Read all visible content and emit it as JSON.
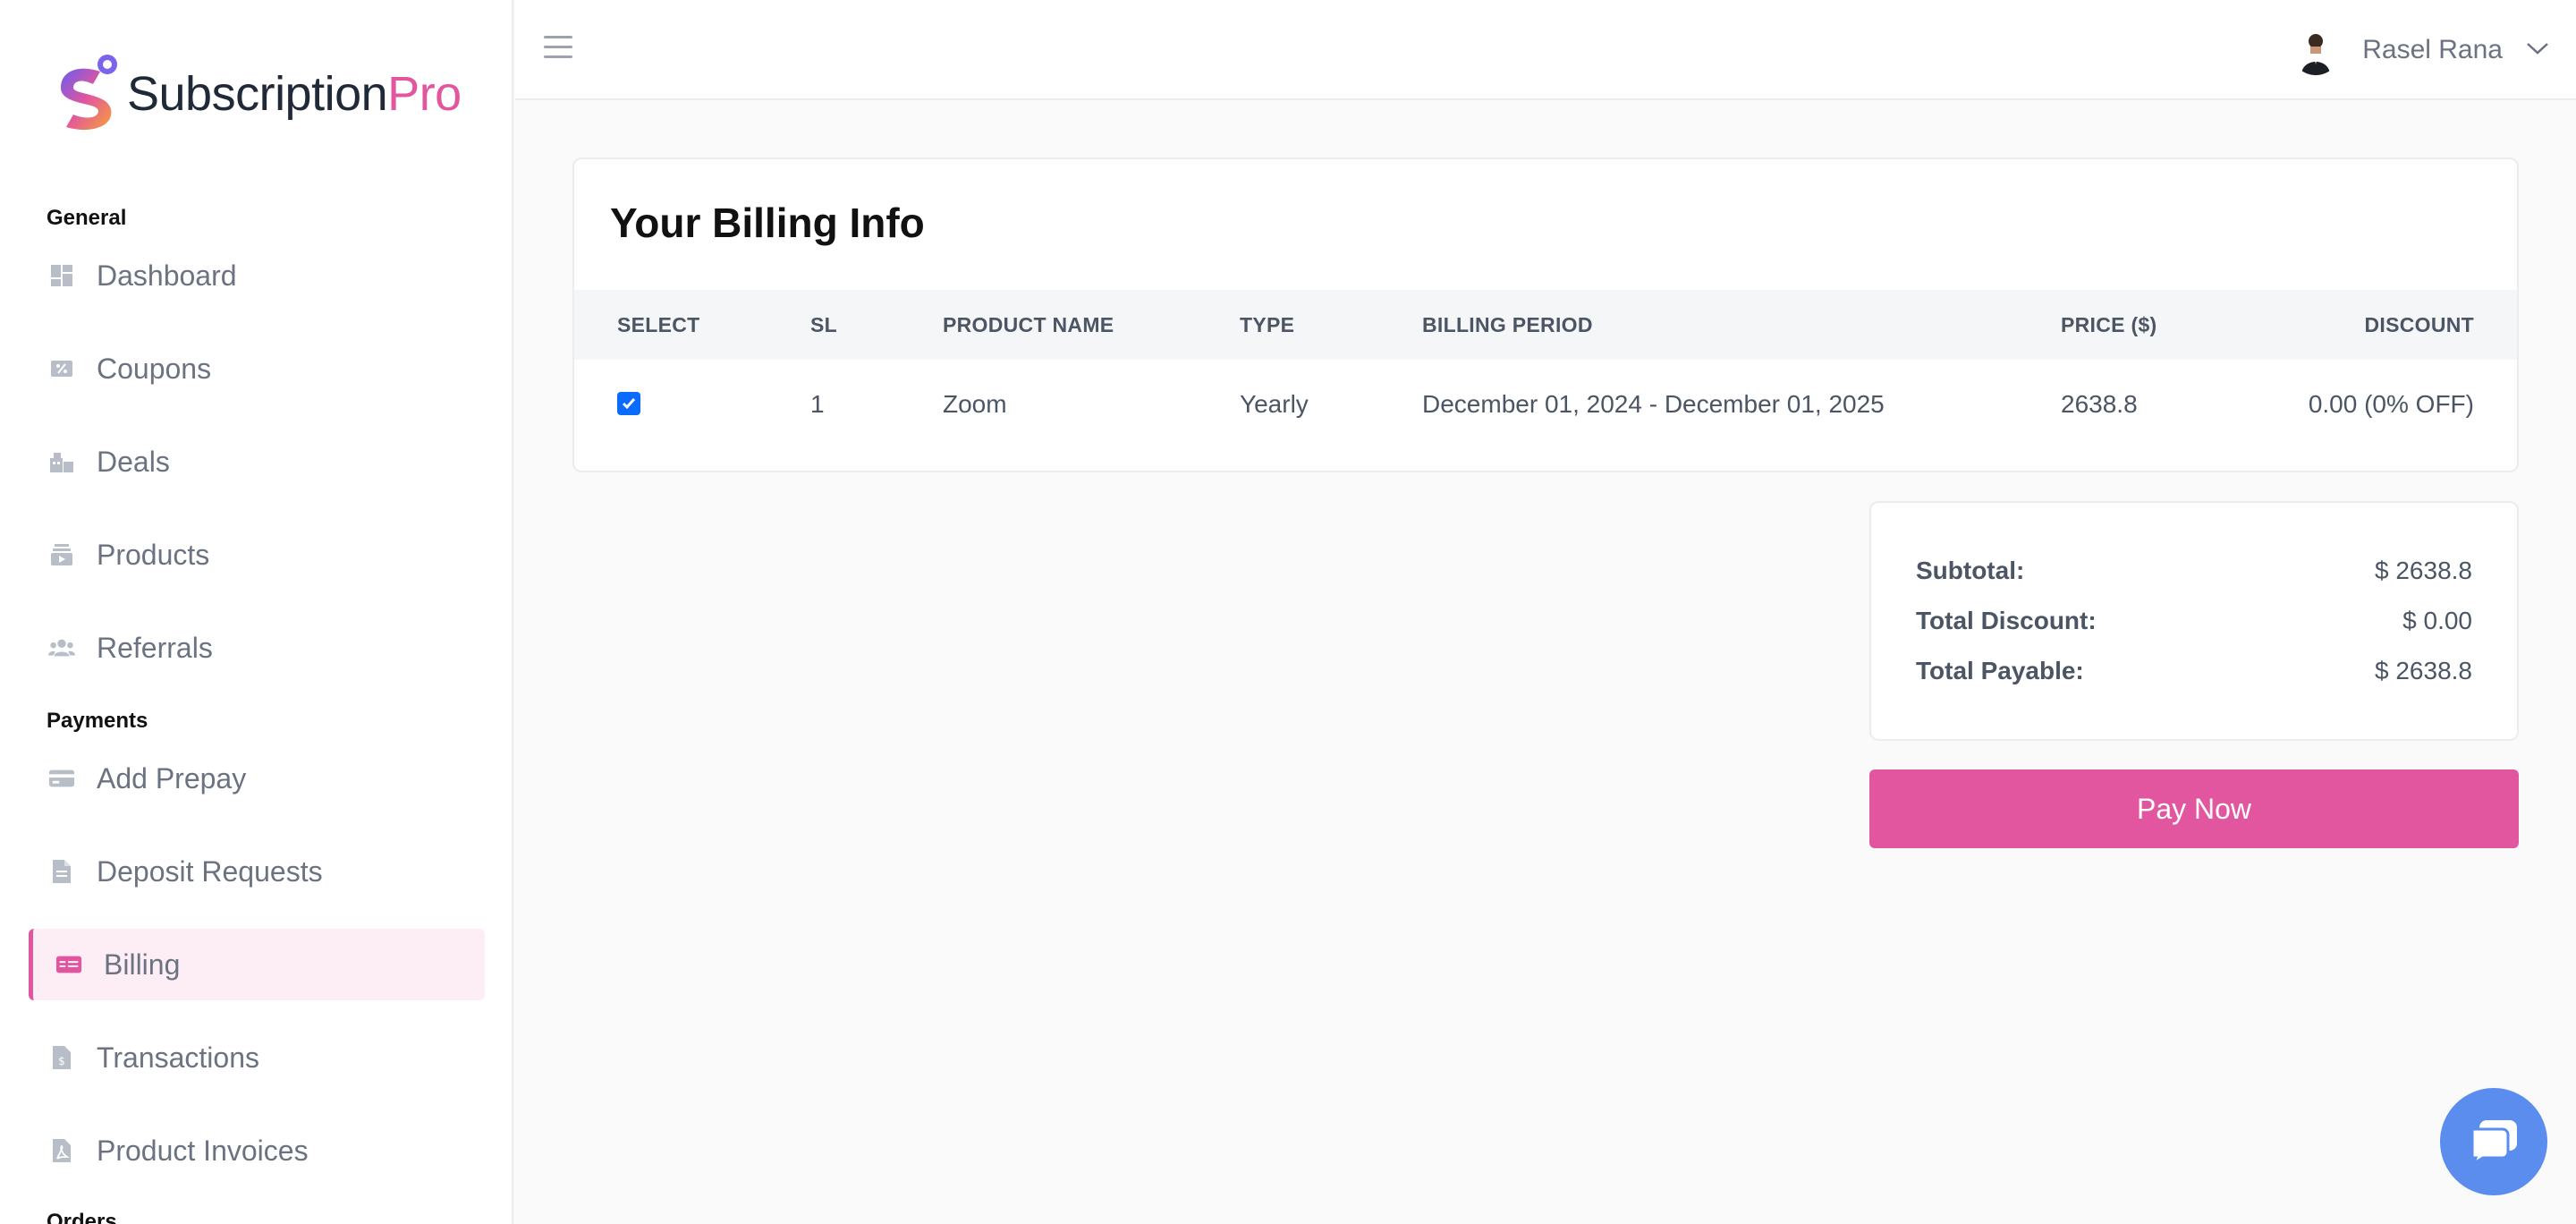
{
  "brand": {
    "name_main": "Subscription",
    "name_accent": "Pro"
  },
  "sidebar": {
    "sections": [
      {
        "title": "General"
      },
      {
        "title": "Payments"
      },
      {
        "title": "Orders"
      }
    ],
    "items": [
      {
        "label": "Dashboard",
        "icon": "dashboard-icon"
      },
      {
        "label": "Coupons",
        "icon": "coupon-icon"
      },
      {
        "label": "Deals",
        "icon": "deals-icon"
      },
      {
        "label": "Products",
        "icon": "products-icon"
      },
      {
        "label": "Referrals",
        "icon": "referrals-icon"
      },
      {
        "label": "Add Prepay",
        "icon": "card-icon"
      },
      {
        "label": "Deposit Requests",
        "icon": "document-icon"
      },
      {
        "label": "Billing",
        "icon": "billing-icon",
        "active": true
      },
      {
        "label": "Transactions",
        "icon": "invoice-dollar-icon"
      },
      {
        "label": "Product Invoices",
        "icon": "pdf-file-icon"
      }
    ]
  },
  "header": {
    "user_name": "Rasel Rana"
  },
  "billing": {
    "title": "Your Billing Info",
    "columns": [
      "SELECT",
      "SL",
      "PRODUCT NAME",
      "TYPE",
      "BILLING PERIOD",
      "PRICE ($)",
      "DISCOUNT"
    ],
    "rows": [
      {
        "selected": true,
        "sl": "1",
        "product": "Zoom",
        "type": "Yearly",
        "period": "December 01, 2024 - December 01, 2025",
        "price": "2638.8",
        "discount": "0.00 (0% OFF)"
      }
    ]
  },
  "summary": {
    "subtotal_label": "Subtotal:",
    "subtotal_value": "$ 2638.8",
    "discount_label": "Total Discount:",
    "discount_value": "$ 0.00",
    "payable_label": "Total Payable:",
    "payable_value": "$ 2638.8"
  },
  "pay_button": "Pay Now",
  "colors": {
    "accent": "#e2559f",
    "active_bg": "#fdeef6",
    "checkbox": "#0b6bff",
    "chat": "#5b8def"
  }
}
